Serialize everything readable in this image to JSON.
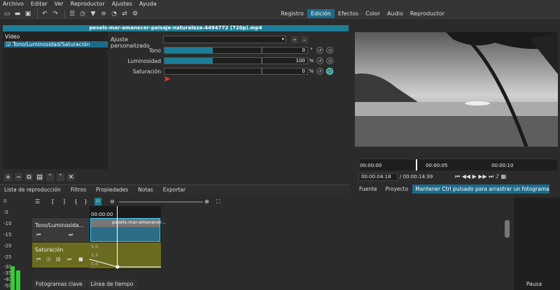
{
  "menu": [
    "Archivo",
    "Editar",
    "Ver",
    "Reproductor",
    "Ajustes",
    "Ayuda"
  ],
  "modes": [
    "Registro",
    "Edición",
    "Efectos",
    "Color",
    "Audio",
    "Reproductor"
  ],
  "active_mode": "Edición",
  "clip_title": "pexels-mar-amanecer-paisaje-naturaleza-4494772 (720p).mp4",
  "filters": {
    "category": "Vídeo",
    "item": "Tono/Luminosidad/Saturación"
  },
  "preset": {
    "label": "Ajuste personalizado",
    "value": ""
  },
  "params": [
    {
      "label": "Tono",
      "value": "0",
      "unit": "°",
      "fill": 0.5
    },
    {
      "label": "Luminosidad",
      "value": "100",
      "unit": "%",
      "fill": 0.5
    },
    {
      "label": "Saturación",
      "value": "0",
      "unit": "%",
      "fill": 0
    }
  ],
  "tabs": [
    "Lista de reproducción",
    "Filtros",
    "Propiedades",
    "Notas",
    "Exportar"
  ],
  "player": {
    "ruler": [
      "00:00:00",
      "00:00:05",
      "00:00:10"
    ],
    "current": "00:00:04:18",
    "total": "/ 00:00:14:39"
  },
  "panel_tabs": [
    "Fuente",
    "Proyecto"
  ],
  "status": "Mantener Ctrl pulsado para arrastrar un fotograma cl...",
  "levels": [
    "0",
    "-5",
    "-10",
    "-15",
    "-20",
    "-25",
    "-30",
    "-35",
    "-40",
    "-50"
  ],
  "timeline": {
    "time": "00:00:00",
    "clip": "pexels-mar-amanecer...",
    "tracks": [
      "Tono/Luminosida...",
      "Saturación"
    ],
    "kf_labels": [
      "5,0",
      "2,5",
      "0,0"
    ]
  },
  "bottom_tabs": [
    "Fotogramas clave",
    "Línea de tiempo"
  ],
  "pause": "Pausa"
}
